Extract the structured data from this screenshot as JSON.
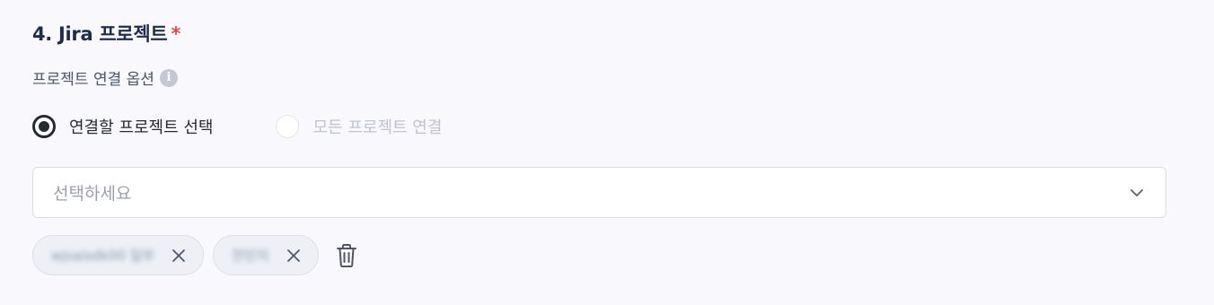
{
  "section": {
    "title": "4. Jira 프로젝트",
    "required_mark": "*"
  },
  "option": {
    "label": "프로젝트 연결 옵션",
    "info_icon": "i"
  },
  "radios": [
    {
      "label": "연결할 프로젝트 선택",
      "checked": true
    },
    {
      "label": "모든 프로젝트 연결",
      "checked": false
    }
  ],
  "select": {
    "placeholder": "선택하세요",
    "icon": "chevron-down-icon"
  },
  "tags": [
    {
      "label": "wjsalsdk00 일부"
    },
    {
      "label": "전민지"
    }
  ],
  "icons": {
    "remove": "close-icon",
    "delete_all": "trash-icon"
  },
  "colors": {
    "title": "#1f2c4b",
    "required": "#e5484d",
    "radio_checked": "#262a33",
    "placeholder": "#9a9fab"
  }
}
